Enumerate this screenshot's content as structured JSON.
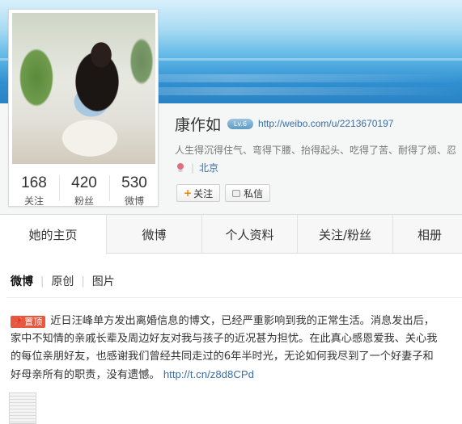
{
  "profile": {
    "name": "康作如",
    "level_badge": "Lv.6",
    "url": "http://weibo.com/u/2213670197",
    "bio": "人生得沉得住气、弯得下腰、抬得起头、吃得了苦、耐得了烦、忍",
    "location": "北京",
    "stats": [
      {
        "num": "168",
        "label": "关注"
      },
      {
        "num": "420",
        "label": "粉丝"
      },
      {
        "num": "530",
        "label": "微博"
      }
    ],
    "follow_btn": "关注",
    "follow_plus": "+",
    "message_btn": "私信"
  },
  "tabs": [
    {
      "label": "她的主页"
    },
    {
      "label": "微博"
    },
    {
      "label": "个人资料"
    },
    {
      "label": "关注/粉丝"
    },
    {
      "label": "相册"
    }
  ],
  "subtabs": [
    {
      "label": "微博"
    },
    {
      "label": "原创"
    },
    {
      "label": "图片"
    }
  ],
  "subtab_separator": "|",
  "post": {
    "pin_label": "置顶",
    "lines": [
      "近日汪峰单方发出离婚信息的博文，已经严重影响到我的正常生活。消息发出后，",
      "家中不知情的亲戚长辈及周边好友对我与孩子的近况甚为担忧。在此真心感恩爱我、关心我",
      "的每位亲朋好友，也感谢我们曾经共同走过的6年半时光，无论如何我尽到了一个好妻子和",
      "好母亲所有的职责，没有遗憾。"
    ],
    "link": "http://t.cn/z8d8CPd"
  },
  "colors": {
    "link_blue": "#3b6ea5",
    "pin_red": "#e8573e",
    "follow_plus_orange": "#f08000"
  }
}
